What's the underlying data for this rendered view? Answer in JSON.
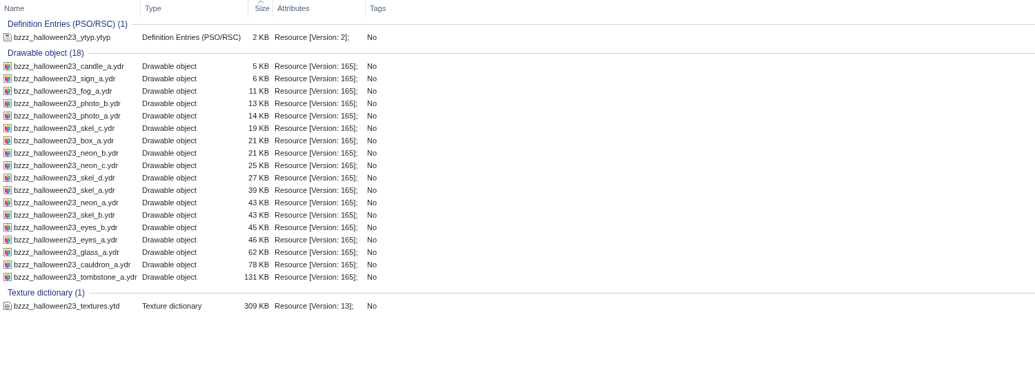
{
  "columns": [
    {
      "label": "Name",
      "sorted": false
    },
    {
      "label": "Type",
      "sorted": false
    },
    {
      "label": "Size",
      "sorted": true
    },
    {
      "label": "Attributes",
      "sorted": false
    },
    {
      "label": "Tags",
      "sorted": false
    }
  ],
  "groups": [
    {
      "title": "Definition Entries (PSO/RSC) (1)",
      "kind": "definition",
      "items": [
        {
          "name": "bzzz_halloween23_ytyp.ytyp",
          "type": "Definition Entries (PSO/RSC)",
          "size": "2 KB",
          "attributes": "Resource [Version: 2];",
          "tags": "No"
        }
      ]
    },
    {
      "title": "Drawable object (18)",
      "kind": "drawable",
      "items": [
        {
          "name": "bzzz_halloween23_candle_a.ydr",
          "type": "Drawable object",
          "size": "5 KB",
          "attributes": "Resource [Version: 165];",
          "tags": "No"
        },
        {
          "name": "bzzz_halloween23_sign_a.ydr",
          "type": "Drawable object",
          "size": "6 KB",
          "attributes": "Resource [Version: 165];",
          "tags": "No"
        },
        {
          "name": "bzzz_halloween23_fog_a.ydr",
          "type": "Drawable object",
          "size": "11 KB",
          "attributes": "Resource [Version: 165];",
          "tags": "No"
        },
        {
          "name": "bzzz_halloween23_photo_b.ydr",
          "type": "Drawable object",
          "size": "13 KB",
          "attributes": "Resource [Version: 165];",
          "tags": "No"
        },
        {
          "name": "bzzz_halloween23_photo_a.ydr",
          "type": "Drawable object",
          "size": "14 KB",
          "attributes": "Resource [Version: 165];",
          "tags": "No"
        },
        {
          "name": "bzzz_halloween23_skel_c.ydr",
          "type": "Drawable object",
          "size": "19 KB",
          "attributes": "Resource [Version: 165];",
          "tags": "No"
        },
        {
          "name": "bzzz_halloween23_box_a.ydr",
          "type": "Drawable object",
          "size": "21 KB",
          "attributes": "Resource [Version: 165];",
          "tags": "No"
        },
        {
          "name": "bzzz_halloween23_neon_b.ydr",
          "type": "Drawable object",
          "size": "21 KB",
          "attributes": "Resource [Version: 165];",
          "tags": "No"
        },
        {
          "name": "bzzz_halloween23_neon_c.ydr",
          "type": "Drawable object",
          "size": "25 KB",
          "attributes": "Resource [Version: 165];",
          "tags": "No"
        },
        {
          "name": "bzzz_halloween23_skel_d.ydr",
          "type": "Drawable object",
          "size": "27 KB",
          "attributes": "Resource [Version: 165];",
          "tags": "No"
        },
        {
          "name": "bzzz_halloween23_skel_a.ydr",
          "type": "Drawable object",
          "size": "39 KB",
          "attributes": "Resource [Version: 165];",
          "tags": "No"
        },
        {
          "name": "bzzz_halloween23_neon_a.ydr",
          "type": "Drawable object",
          "size": "43 KB",
          "attributes": "Resource [Version: 165];",
          "tags": "No"
        },
        {
          "name": "bzzz_halloween23_skel_b.ydr",
          "type": "Drawable object",
          "size": "43 KB",
          "attributes": "Resource [Version: 165];",
          "tags": "No"
        },
        {
          "name": "bzzz_halloween23_eyes_b.ydr",
          "type": "Drawable object",
          "size": "45 KB",
          "attributes": "Resource [Version: 165];",
          "tags": "No"
        },
        {
          "name": "bzzz_halloween23_eyes_a.ydr",
          "type": "Drawable object",
          "size": "46 KB",
          "attributes": "Resource [Version: 165];",
          "tags": "No"
        },
        {
          "name": "bzzz_halloween23_glass_a.ydr",
          "type": "Drawable object",
          "size": "62 KB",
          "attributes": "Resource [Version: 165];",
          "tags": "No"
        },
        {
          "name": "bzzz_halloween23_cauldron_a.ydr",
          "type": "Drawable object",
          "size": "78 KB",
          "attributes": "Resource [Version: 165];",
          "tags": "No"
        },
        {
          "name": "bzzz_halloween23_tombstone_a.ydr",
          "type": "Drawable object",
          "size": "131 KB",
          "attributes": "Resource [Version: 165];",
          "tags": "No"
        }
      ]
    },
    {
      "title": "Texture dictionary (1)",
      "kind": "texture",
      "items": [
        {
          "name": "bzzz_halloween23_textures.ytd",
          "type": "Texture dictionary",
          "size": "309 KB",
          "attributes": "Resource [Version: 13];",
          "tags": "No"
        }
      ]
    }
  ]
}
